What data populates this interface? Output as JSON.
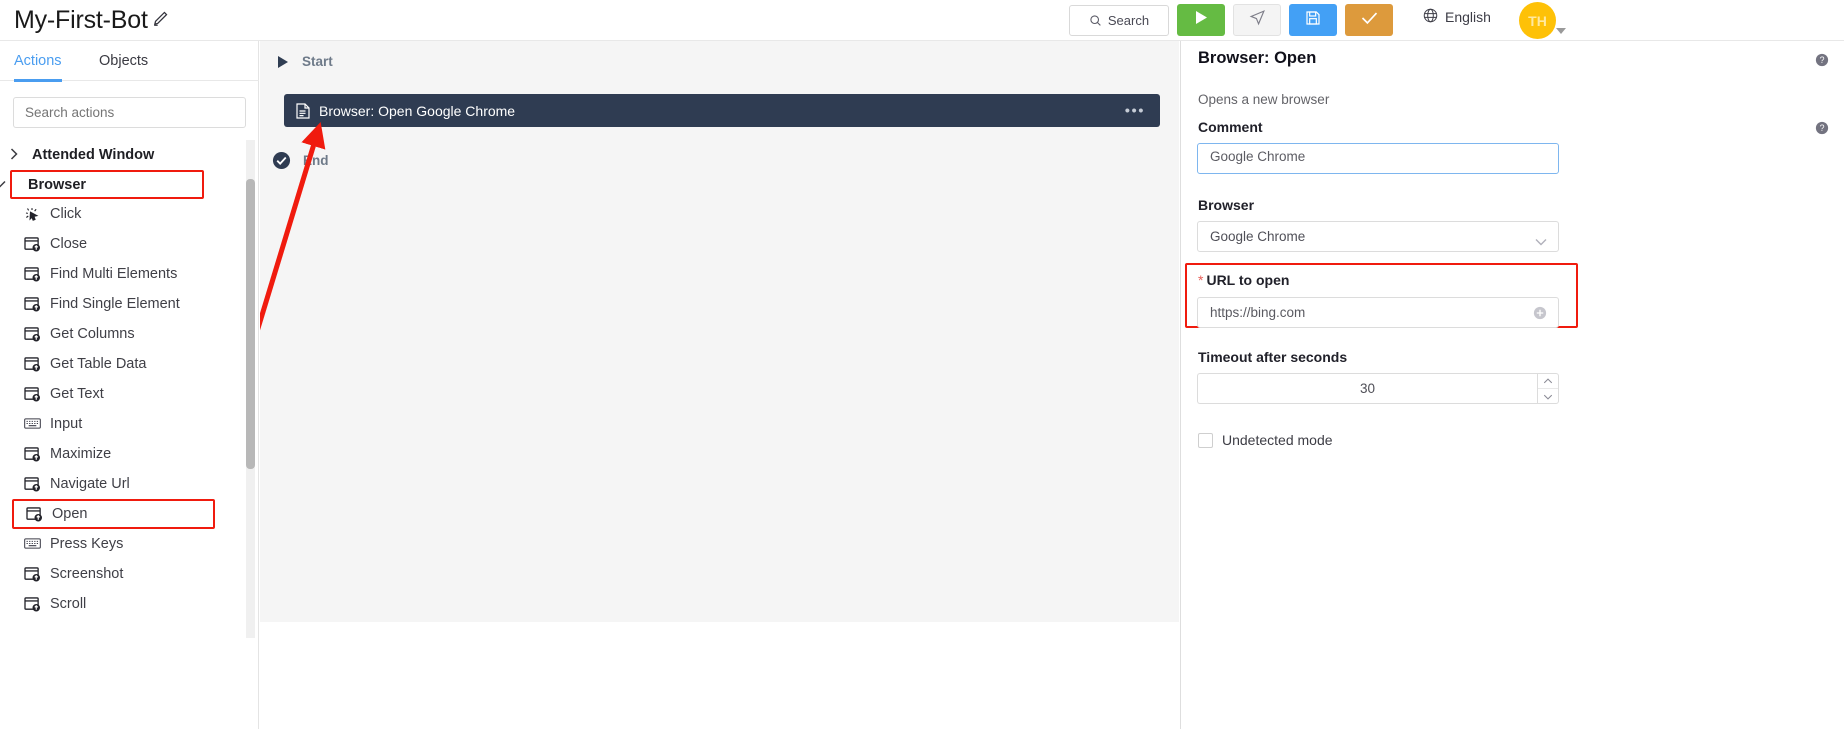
{
  "topbar": {
    "bot_name": "My-First-Bot",
    "edit_icon": "pencil-icon",
    "search_label": "Search",
    "search_icon": "search-icon",
    "run_icon": "play-icon",
    "step_icon": "send-arrow-icon",
    "save_icon": "floppy-disk-icon",
    "check_icon": "checkmark-icon",
    "language": "English",
    "globe_icon": "globe-icon",
    "avatar_initials": "TH",
    "colors": {
      "run": "#65bb43",
      "save": "#43a0f5",
      "check": "#dd9a3c",
      "avatar": "#fec107",
      "accent": "#4a9df0",
      "highlight": "#f01b0e"
    }
  },
  "sidebar": {
    "tabs": [
      {
        "label": "Actions",
        "active": true
      },
      {
        "label": "Objects",
        "active": false
      }
    ],
    "search_placeholder": "Search actions",
    "groups": [
      {
        "label": "Attended Window",
        "expanded": false,
        "chevron": "chevron-right-icon",
        "highlighted": false
      },
      {
        "label": "Browser",
        "expanded": true,
        "chevron": "chevron-down-icon",
        "highlighted": true
      }
    ],
    "actions": [
      {
        "label": "Click",
        "icon": "click-cursor-icon",
        "highlighted": false
      },
      {
        "label": "Close",
        "icon": "browser-window-icon",
        "highlighted": false
      },
      {
        "label": "Find Multi Elements",
        "icon": "browser-window-icon",
        "highlighted": false
      },
      {
        "label": "Find Single Element",
        "icon": "browser-window-icon",
        "highlighted": false
      },
      {
        "label": "Get Columns",
        "icon": "browser-window-icon",
        "highlighted": false
      },
      {
        "label": "Get Table Data",
        "icon": "browser-window-icon",
        "highlighted": false
      },
      {
        "label": "Get Text",
        "icon": "browser-window-icon",
        "highlighted": false
      },
      {
        "label": "Input",
        "icon": "keyboard-icon",
        "highlighted": false
      },
      {
        "label": "Maximize",
        "icon": "browser-window-icon",
        "highlighted": false
      },
      {
        "label": "Navigate Url",
        "icon": "browser-window-icon",
        "highlighted": false
      },
      {
        "label": "Open",
        "icon": "browser-window-icon",
        "highlighted": true
      },
      {
        "label": "Press Keys",
        "icon": "keyboard-icon",
        "highlighted": false
      },
      {
        "label": "Screenshot",
        "icon": "browser-window-icon",
        "highlighted": false
      },
      {
        "label": "Scroll",
        "icon": "browser-window-icon",
        "highlighted": false
      }
    ]
  },
  "canvas": {
    "start_label": "Start",
    "start_icon": "play-triangle-icon",
    "node": {
      "label": "Browser: Open Google Chrome",
      "icon": "document-icon",
      "menu_icon": "ellipsis-icon"
    },
    "end_label": "End",
    "end_icon": "check-circle-icon"
  },
  "panel": {
    "title": "Browser: Open",
    "help_icon": "help-circle-icon",
    "description": "Opens a new browser",
    "comment": {
      "label": "Comment",
      "value": "Google Chrome"
    },
    "browser": {
      "label": "Browser",
      "value": "Google Chrome",
      "chevron": "chevron-down-icon"
    },
    "url": {
      "label": "URL to open",
      "required_marker": "*",
      "value": "https://bing.com",
      "add_icon": "plus-circle-icon",
      "highlighted": true
    },
    "timeout": {
      "label": "Timeout after seconds",
      "value": "30",
      "up_icon": "chevron-up-icon",
      "down_icon": "chevron-down-icon"
    },
    "undetected": {
      "label": "Undetected mode",
      "checked": false
    }
  }
}
